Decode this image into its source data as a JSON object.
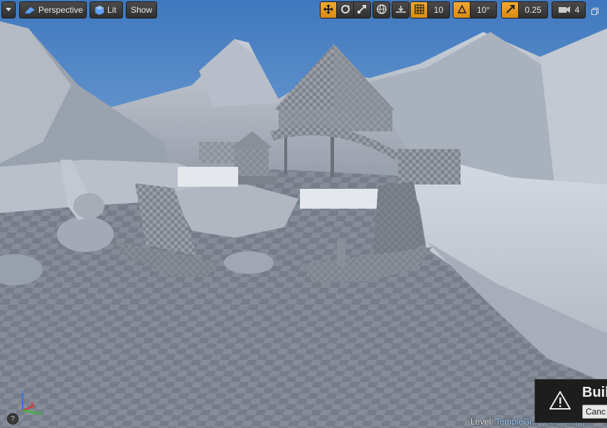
{
  "toolbar": {
    "view_mode": "Perspective",
    "lighting_mode": "Lit",
    "show_label": "Show",
    "grid_snap_value": "10",
    "rotation_snap_value": "10°",
    "scale_snap_value": "0.25",
    "camera_speed_value": "4"
  },
  "footer": {
    "level_prefix": "Level:",
    "level_name": "TempleGr... (Persistent)"
  },
  "notification": {
    "title": "Buil",
    "cancel_label": "Canc"
  },
  "icons": {
    "menu": "chevron-down-icon",
    "perspective": "perspective-icon",
    "lit": "cube-icon",
    "translate": "move-icon",
    "rotate": "rotate-icon",
    "scale": "scale-icon",
    "world": "globe-icon",
    "surface_snap": "surface-snap-icon",
    "grid": "grid-icon",
    "angle": "angle-icon",
    "scale_snap": "scale-snap-icon",
    "camera": "camera-icon",
    "warning": "warning-icon",
    "help": "help-icon",
    "maximize": "maximize-icon"
  },
  "colors": {
    "active_accent": "#e0961c",
    "toolbar_bg": "#3a3a3a",
    "sky_top": "#3f78bf",
    "sky_bottom": "#b8cfe6"
  }
}
